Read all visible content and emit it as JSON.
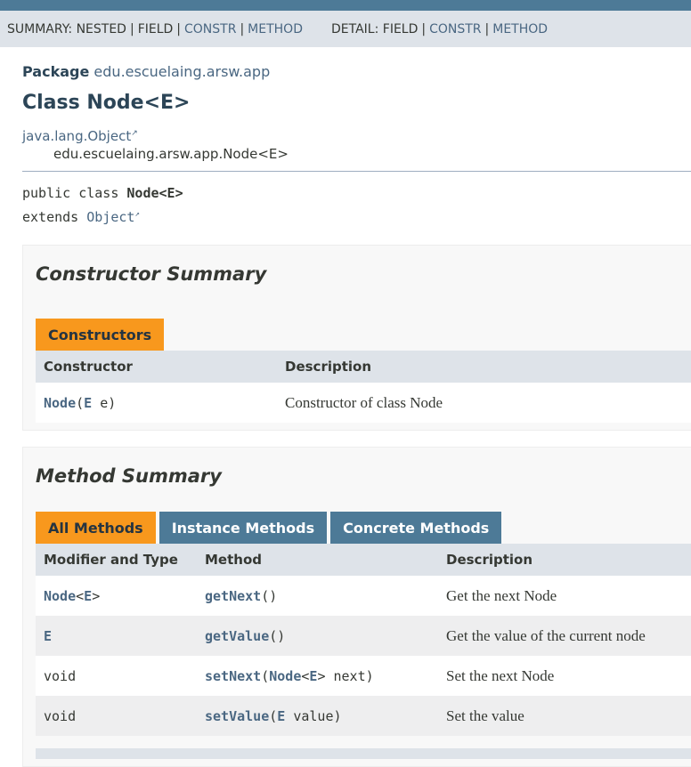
{
  "subnav": {
    "summary_label": "SUMMARY:",
    "summary_nested": "NESTED",
    "summary_field": "FIELD",
    "summary_constr": "CONSTR",
    "summary_method": "METHOD",
    "detail_label": "DETAIL:",
    "detail_field": "FIELD",
    "detail_constr": "CONSTR",
    "detail_method": "METHOD",
    "separator": "|"
  },
  "header": {
    "package_label": "Package",
    "package_name": "edu.escuelaing.arsw.app",
    "class_title": "Class Node<E>",
    "inherit_parent": "java.lang.Object",
    "inherit_child": "edu.escuelaing.arsw.app.Node<E>"
  },
  "signature": {
    "line1_prefix": "public class ",
    "line1_name": "Node<E>",
    "line2_prefix": "extends ",
    "line2_link": "Object"
  },
  "constructor_summary": {
    "title": "Constructor Summary",
    "tab_label": "Constructors",
    "col_constructor": "Constructor",
    "col_description": "Description",
    "rows": [
      {
        "name": "Node",
        "open": "(",
        "type": "E",
        "param": " e)",
        "description": "Constructor of class Node"
      }
    ]
  },
  "method_summary": {
    "title": "Method Summary",
    "tabs": [
      "All Methods",
      "Instance Methods",
      "Concrete Methods"
    ],
    "col_modifier": "Modifier and Type",
    "col_method": "Method",
    "col_description": "Description",
    "rows": [
      {
        "mod_link": "Node",
        "mod_rest": "<",
        "mod_link2": "E",
        "mod_rest2": ">",
        "name": "getNext",
        "args_plain": "()",
        "description": "Get the next Node"
      },
      {
        "mod_link": "E",
        "name": "getValue",
        "args_plain": "()",
        "description": "Get the value of the current node"
      },
      {
        "mod_plain": "void",
        "name": "setNext",
        "open": "(",
        "arg_link": "Node",
        "lt": "<",
        "arg_link2": "E",
        "rest": "> next)",
        "description": "Set the next Node"
      },
      {
        "mod_plain": "void",
        "name": "setValue",
        "open": "(",
        "arg_link": "E",
        "rest": " value)",
        "description": "Set the value"
      }
    ]
  },
  "icons": {
    "external_link": "external-link-icon"
  },
  "colors": {
    "nav_bar": "#4d7a97",
    "subnav_bg": "#dee3e9",
    "active_tab": "#f8981d",
    "link": "#4a6782"
  }
}
